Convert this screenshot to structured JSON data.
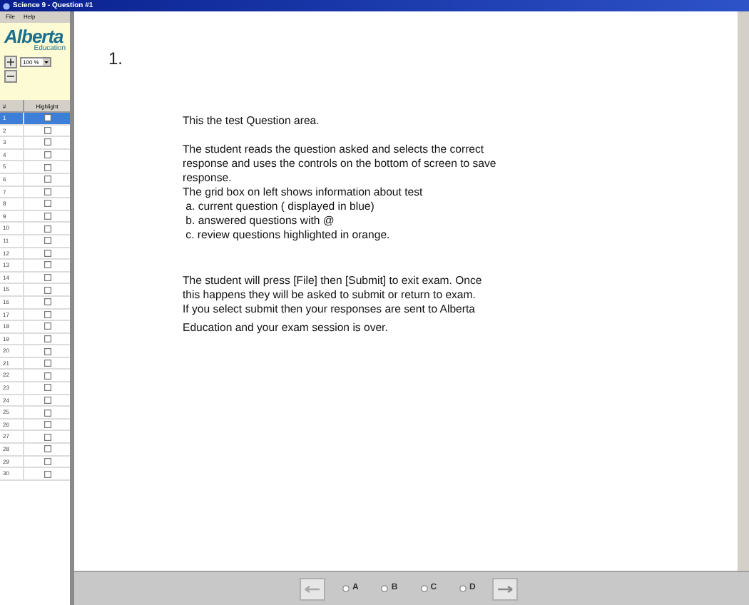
{
  "window": {
    "title": "Science 9 - Question #1"
  },
  "menu": [
    "File",
    "Help"
  ],
  "logo": {
    "name": "Alberta",
    "subtitle": "Education"
  },
  "zoom": {
    "value": "100 %"
  },
  "grid": {
    "columns": [
      "#",
      "Highlight"
    ],
    "rows": [
      {
        "number": "1",
        "selected": true,
        "checked": false
      },
      {
        "number": "2",
        "selected": false,
        "checked": false
      },
      {
        "number": "3",
        "selected": false,
        "checked": false
      },
      {
        "number": "4",
        "selected": false,
        "checked": false
      },
      {
        "number": "5",
        "selected": false,
        "checked": false
      },
      {
        "number": "6",
        "selected": false,
        "checked": false
      },
      {
        "number": "7",
        "selected": false,
        "checked": false
      },
      {
        "number": "8",
        "selected": false,
        "checked": false
      },
      {
        "number": "9",
        "selected": false,
        "checked": false
      },
      {
        "number": "10",
        "selected": false,
        "checked": false
      },
      {
        "number": "11",
        "selected": false,
        "checked": false
      },
      {
        "number": "12",
        "selected": false,
        "checked": false
      },
      {
        "number": "13",
        "selected": false,
        "checked": false
      },
      {
        "number": "14",
        "selected": false,
        "checked": false
      },
      {
        "number": "15",
        "selected": false,
        "checked": false
      },
      {
        "number": "16",
        "selected": false,
        "checked": false
      },
      {
        "number": "17",
        "selected": false,
        "checked": false
      },
      {
        "number": "18",
        "selected": false,
        "checked": false
      },
      {
        "number": "19",
        "selected": false,
        "checked": false
      },
      {
        "number": "20",
        "selected": false,
        "checked": false
      },
      {
        "number": "21",
        "selected": false,
        "checked": false
      },
      {
        "number": "22",
        "selected": false,
        "checked": false
      },
      {
        "number": "23",
        "selected": false,
        "checked": false
      },
      {
        "number": "24",
        "selected": false,
        "checked": false
      },
      {
        "number": "25",
        "selected": false,
        "checked": false
      },
      {
        "number": "26",
        "selected": false,
        "checked": false
      },
      {
        "number": "27",
        "selected": false,
        "checked": false
      },
      {
        "number": "28",
        "selected": false,
        "checked": false
      },
      {
        "number": "29",
        "selected": false,
        "checked": false
      },
      {
        "number": "30",
        "selected": false,
        "checked": false
      }
    ]
  },
  "question": {
    "number": "1.",
    "blocks": [
      {
        "lines": [
          "This the test Question area."
        ]
      },
      {
        "lines": [
          "The student reads the question asked and selects the correct",
          "response and uses the controls on the bottom of screen to save",
          "response.",
          "The grid box on left shows information about test",
          " a. current question ( displayed in blue)",
          " b. answered questions with @",
          " c. review questions highlighted in orange."
        ]
      },
      {
        "lines": [
          "The student will press [File] then [Submit] to exit exam. Once",
          "this happens they will be asked to submit or return to exam.",
          "If you select submit then your responses are sent to Alberta"
        ]
      },
      {
        "lines": [
          "Education and your exam session is over."
        ]
      }
    ]
  },
  "answers": [
    {
      "label": "A",
      "selected": false
    },
    {
      "label": "B",
      "selected": false
    },
    {
      "label": "C",
      "selected": false
    },
    {
      "label": "D",
      "selected": false
    }
  ]
}
